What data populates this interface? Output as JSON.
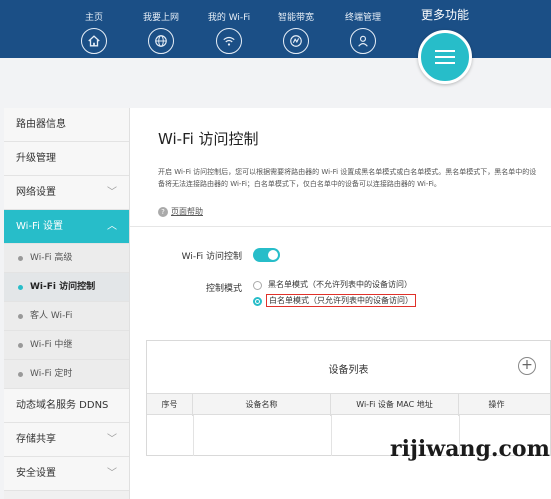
{
  "nav": {
    "items": [
      {
        "label": "主页",
        "icon": "home-icon"
      },
      {
        "label": "我要上网",
        "icon": "globe-icon"
      },
      {
        "label": "我的 Wi-Fi",
        "icon": "wifi-icon"
      },
      {
        "label": "智能带宽",
        "icon": "bandwidth-icon"
      },
      {
        "label": "终端管理",
        "icon": "user-icon"
      }
    ],
    "more_label": "更多功能",
    "more_icon": "menu-icon"
  },
  "sidebar": {
    "items": [
      {
        "label": "路由器信息"
      },
      {
        "label": "升级管理"
      },
      {
        "label": "网络设置",
        "chevron": "chevron-down-icon"
      },
      {
        "label": "Wi-Fi 设置",
        "chevron": "chevron-up-icon",
        "active": true
      },
      {
        "label": "动态域名服务 DDNS"
      },
      {
        "label": "存储共享",
        "chevron": "chevron-down-icon"
      },
      {
        "label": "安全设置",
        "chevron": "chevron-down-icon"
      }
    ],
    "subitems": [
      {
        "label": "Wi-Fi 高级"
      },
      {
        "label": "Wi-Fi 访问控制",
        "current": true
      },
      {
        "label": "客人 Wi-Fi"
      },
      {
        "label": "Wi-Fi 中继"
      },
      {
        "label": "Wi-Fi 定时"
      }
    ]
  },
  "main": {
    "title": "Wi-Fi 访问控制",
    "description": "开启 Wi-Fi 访问控制后，您可以根据需要将路由器的 Wi-Fi 设置成黑名单模式或白名单模式。黑名单模式下，黑名单中的设备将无法连接路由器的 Wi-Fi；白名单模式下，仅白名单中的设备可以连接路由器的 Wi-Fi。",
    "help_link": "页面帮助",
    "access_control_label": "Wi-Fi 访问控制",
    "access_control_enabled": true,
    "mode_label": "控制模式",
    "modes": [
      {
        "label": "黑名单模式（不允许列表中的设备访问）",
        "selected": false
      },
      {
        "label": "白名单模式（只允许列表中的设备访问）",
        "selected": true
      }
    ],
    "device_list": {
      "title": "设备列表",
      "add_label": "+",
      "columns": [
        "序号",
        "设备名称",
        "Wi-Fi 设备 MAC 地址",
        "操作"
      ]
    }
  },
  "watermark": "rijiwang.com",
  "colors": {
    "nav_bg": "#1b4f86",
    "accent": "#27bdc9",
    "highlight_border": "#e0312a"
  }
}
